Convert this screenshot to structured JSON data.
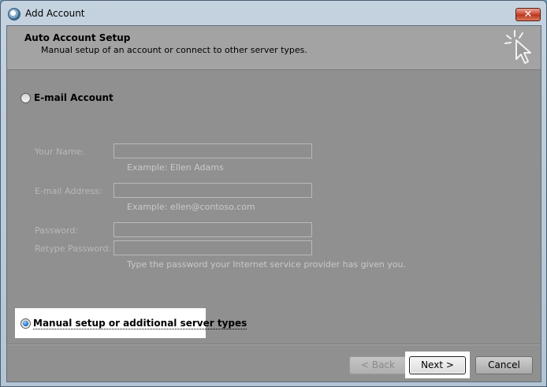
{
  "window": {
    "title": "Add Account",
    "close_label": "✕"
  },
  "header": {
    "title": "Auto Account Setup",
    "subtitle": "Manual setup of an account or connect to other server types.",
    "icon": "cursor-sparkle-icon"
  },
  "email_option": {
    "label": "E-mail Account",
    "checked": false
  },
  "fields": {
    "your_name": {
      "label": "Your Name:",
      "value": "",
      "hint": "Example: Ellen Adams"
    },
    "email_address": {
      "label": "E-mail Address:",
      "value": "",
      "hint": "Example: ellen@contoso.com"
    },
    "password": {
      "label": "Password:",
      "value": ""
    },
    "retype_password": {
      "label": "Retype Password:",
      "value": "",
      "hint": "Type the password your Internet service provider has given you."
    }
  },
  "manual_option": {
    "label": "Manual setup or additional server types",
    "checked": true
  },
  "buttons": {
    "back": "< Back",
    "next": "Next >",
    "cancel": "Cancel"
  }
}
